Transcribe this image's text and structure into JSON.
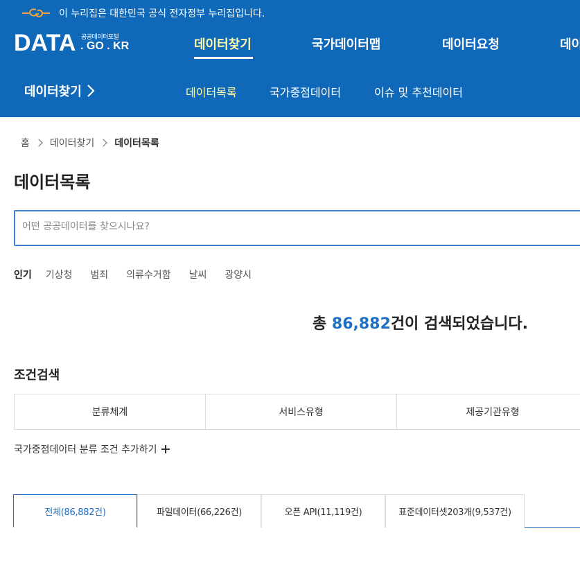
{
  "gov_banner": {
    "text": "이 누리집은 대한민국 공식 전자정부 누리집입니다."
  },
  "logo": {
    "main": "DATA",
    "sub": "공공데이터포털",
    "domain": ". GO . KR"
  },
  "gnb": {
    "items": [
      {
        "label": "데이터찾기"
      },
      {
        "label": "국가데이터맵"
      },
      {
        "label": "데이터요청"
      },
      {
        "label": "데이"
      }
    ]
  },
  "lnb": {
    "title": "데이터찾기",
    "items": [
      {
        "label": "데이터목록"
      },
      {
        "label": "국가중점데이터"
      },
      {
        "label": "이슈 및 추천데이터"
      }
    ]
  },
  "breadcrumb": {
    "items": [
      "홈",
      "데이터찾기",
      "데이터목록"
    ]
  },
  "page": {
    "title": "데이터목록"
  },
  "search": {
    "placeholder": "어떤 공공데이터를 찾으시나요?",
    "value": ""
  },
  "popular": {
    "label": "인기",
    "tags": [
      "기상청",
      "범죄",
      "의류수거함",
      "날씨",
      "광양시"
    ]
  },
  "results": {
    "prefix": "총 ",
    "count": "86,882",
    "suffix": "건이 검색되었습니다."
  },
  "conditions": {
    "title": "조건검색",
    "tabs": [
      "분류체계",
      "서비스유형",
      "제공기관유형"
    ],
    "add_label": "국가중점데이터 분류 조건 추가하기"
  },
  "result_tabs": [
    {
      "label": "전체(86,882건)"
    },
    {
      "label": "파일데이터(66,226건)"
    },
    {
      "label": "오픈 API(11,119건)"
    },
    {
      "label": "표준데이터셋203개(9,537건)"
    }
  ],
  "colors": {
    "header_bg": "#0f69b8",
    "accent": "#1f6fc2",
    "active_menu": "#fffba8"
  }
}
